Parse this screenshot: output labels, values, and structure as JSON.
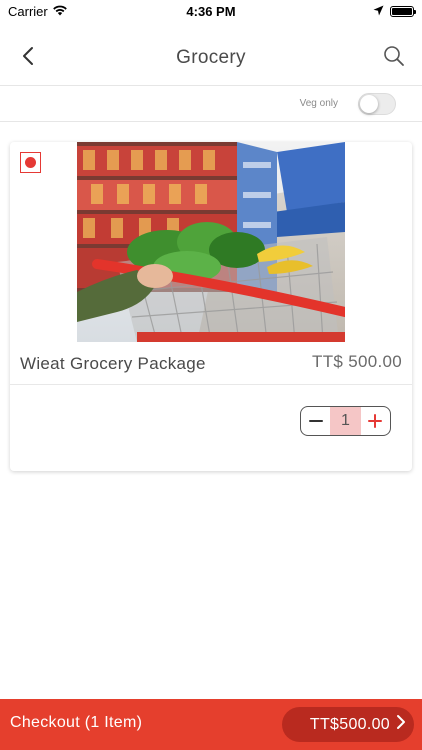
{
  "status_bar": {
    "carrier": "Carrier",
    "time": "4:36 PM"
  },
  "nav": {
    "title": "Grocery",
    "back_icon": "chevron-left-icon",
    "search_icon": "search-icon"
  },
  "filter": {
    "veg_only_label": "Veg only",
    "veg_only_on": false
  },
  "product": {
    "name": "Wieat Grocery Package",
    "price": "TT$ 500.00",
    "quantity": "1",
    "image": "shopping-cart-in-grocery-aisle-photo",
    "indicator_color": "#e53935"
  },
  "checkout": {
    "label": "Checkout (1 Item)",
    "total": "TT$500.00"
  },
  "colors": {
    "accent": "#e53f2d",
    "accent_dark": "#b92a1f",
    "stepper_fill": "#f5c6c6"
  }
}
